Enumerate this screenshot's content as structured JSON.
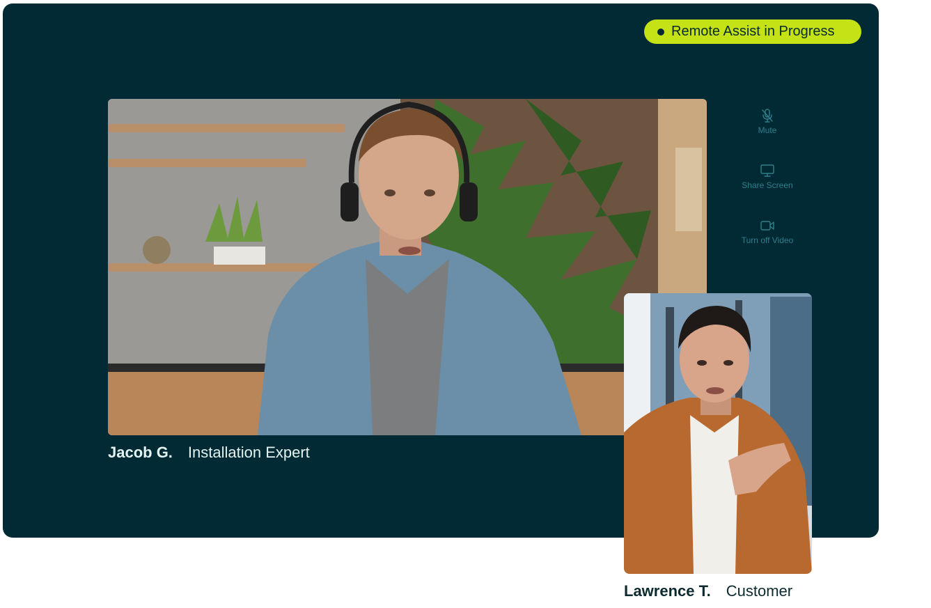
{
  "status": {
    "label": "Remote Assist in Progress"
  },
  "main_participant": {
    "name": "Jacob G.",
    "role": "Installation Expert"
  },
  "secondary_participant": {
    "name": "Lawrence T.",
    "role": "Customer"
  },
  "controls": [
    {
      "label": "Mute",
      "icon": "microphone-off-icon"
    },
    {
      "label": "Share Screen",
      "icon": "monitor-icon"
    },
    {
      "label": "Turn off Video",
      "icon": "video-camera-icon"
    }
  ],
  "colors": {
    "panel_background": "#022a35",
    "badge_background": "#c5e216",
    "control_color": "#2f7f8b",
    "caption_light": "#e3f3f0",
    "caption_dark": "#0c2a30"
  }
}
